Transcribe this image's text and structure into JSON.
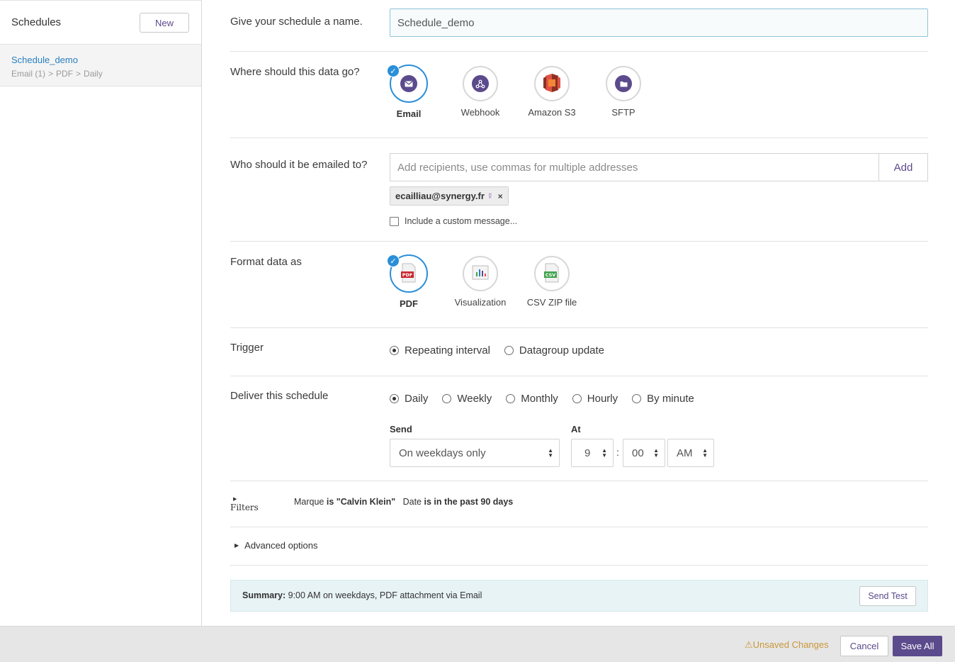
{
  "sidebar": {
    "title": "Schedules",
    "new_label": "New",
    "items": [
      {
        "name": "Schedule_demo",
        "path": [
          "Email (1)",
          "PDF",
          "Daily"
        ]
      }
    ]
  },
  "name_section": {
    "label": "Give your schedule a name.",
    "value": "Schedule_demo"
  },
  "destination": {
    "label": "Where should this data go?",
    "options": [
      {
        "label": "Email",
        "icon": "email-icon",
        "selected": true
      },
      {
        "label": "Webhook",
        "icon": "webhook-icon",
        "selected": false
      },
      {
        "label": "Amazon S3",
        "icon": "amazon-s3-icon",
        "selected": false
      },
      {
        "label": "SFTP",
        "icon": "sftp-folder-icon",
        "selected": false
      }
    ]
  },
  "recipients": {
    "label": "Who should it be emailed to?",
    "placeholder": "Add recipients, use commas for multiple addresses",
    "add_label": "Add",
    "chips": [
      "ecailliau@synergy.fr"
    ],
    "custom_message_label": "Include a custom message..."
  },
  "format": {
    "label": "Format data as",
    "options": [
      {
        "label": "PDF",
        "icon": "pdf-file-icon",
        "selected": true
      },
      {
        "label": "Visualization",
        "icon": "visualization-chart-icon",
        "selected": false
      },
      {
        "label": "CSV ZIP file",
        "icon": "csv-file-icon",
        "selected": false
      }
    ]
  },
  "trigger": {
    "label": "Trigger",
    "options": [
      {
        "label": "Repeating interval",
        "selected": true
      },
      {
        "label": "Datagroup update",
        "selected": false
      }
    ]
  },
  "delivery": {
    "label": "Deliver this schedule",
    "options": [
      {
        "label": "Daily",
        "selected": true
      },
      {
        "label": "Weekly",
        "selected": false
      },
      {
        "label": "Monthly",
        "selected": false
      },
      {
        "label": "Hourly",
        "selected": false
      },
      {
        "label": "By minute",
        "selected": false
      }
    ],
    "send_label": "Send",
    "send_value": "On weekdays only",
    "at_label": "At",
    "hour": "9",
    "colon": ":",
    "minute": "00",
    "ampm": "AM"
  },
  "filters": {
    "label": "Filters",
    "f1_field": "Marque",
    "f1_cond": "is \"Calvin Klein\"",
    "f2_field": "Date",
    "f2_cond": "is in the past 90 days"
  },
  "advanced": {
    "label": "Advanced options"
  },
  "summary": {
    "prefix": "Summary:",
    "text": "9:00 AM on weekdays, PDF attachment via Email",
    "send_test_label": "Send Test"
  },
  "footer": {
    "unsaved": "Unsaved Changes",
    "cancel": "Cancel",
    "save_all": "Save All"
  },
  "colors": {
    "accent": "#5b4a8c",
    "selected_ring": "#2a8fd8",
    "link": "#2a80c2",
    "warning": "#c9973a"
  }
}
